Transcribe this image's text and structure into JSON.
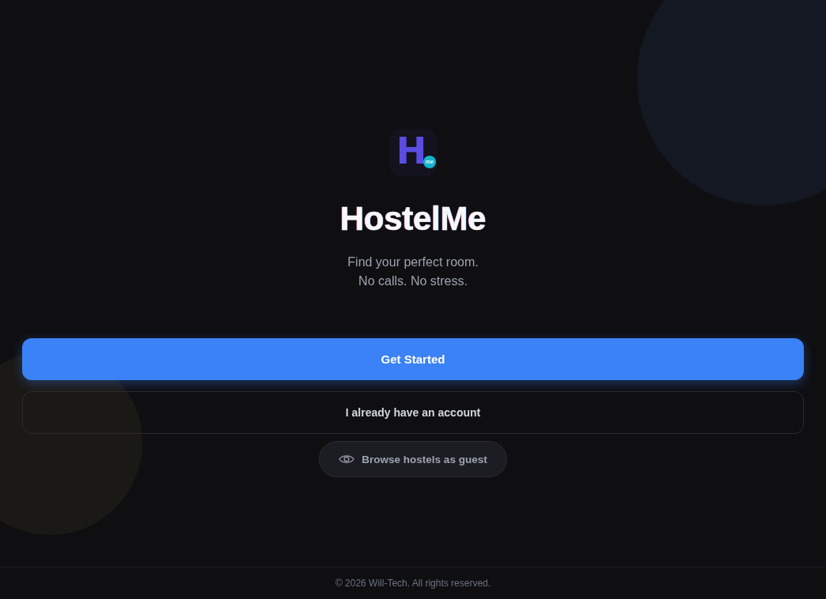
{
  "logo": {
    "mark": "H",
    "badge": "me"
  },
  "title": "HostelMe",
  "tagline": [
    "Find your perfect room.",
    "No calls. No stress."
  ],
  "actions": [
    {
      "kind": "primary",
      "label": "Get Started"
    },
    {
      "kind": "outline",
      "label": "I already have an account"
    },
    {
      "kind": "pill",
      "label": "Browse hostels as guest"
    }
  ],
  "footer": {
    "copyright": "© 2026 Will-Tech. All rights reserved."
  }
}
